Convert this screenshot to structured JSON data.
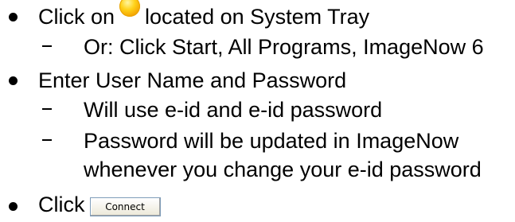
{
  "items": [
    {
      "before": "Click on",
      "after": "located on System Tray",
      "icon": "imagenow-tray-icon"
    },
    {
      "text": "Or: Click Start, All Programs, ImageNow 6"
    },
    {
      "text": "Enter User Name and Password"
    },
    {
      "text": "Will use e-id and e-id password"
    },
    {
      "text": "Password will be updated in ImageNow"
    },
    {
      "text": "whenever you change your e-id password"
    },
    {
      "text": "Click",
      "button_label": "Connect"
    }
  ]
}
